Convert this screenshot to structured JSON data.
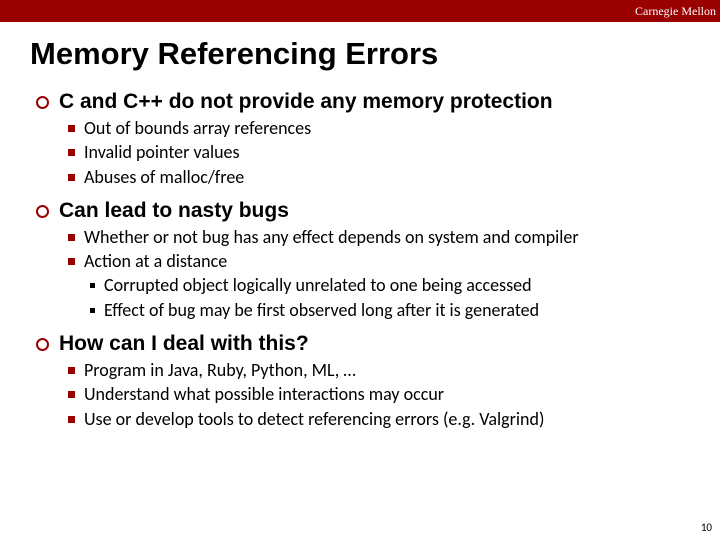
{
  "brand": "Carnegie Mellon",
  "title": "Memory Referencing Errors",
  "sections": [
    {
      "heading": "C and C++ do not provide any memory protection",
      "items": [
        {
          "text": "Out of bounds array references"
        },
        {
          "text": "Invalid pointer values"
        },
        {
          "text": "Abuses of malloc/free"
        }
      ]
    },
    {
      "heading": "Can lead to nasty bugs",
      "items": [
        {
          "text": "Whether or not bug has any effect depends on system and compiler"
        },
        {
          "text": "Action at a distance",
          "sub": [
            "Corrupted object logically unrelated to one being accessed",
            "Effect of bug may be first observed long after it is generated"
          ]
        }
      ]
    },
    {
      "heading": "How can I deal with this?",
      "items": [
        {
          "text": "Program in Java, Ruby, Python, ML, …"
        },
        {
          "text": "Understand what possible interactions may occur"
        },
        {
          "text": "Use or develop tools to detect referencing errors (e.g. Valgrind)"
        }
      ]
    }
  ],
  "page_number": "10"
}
